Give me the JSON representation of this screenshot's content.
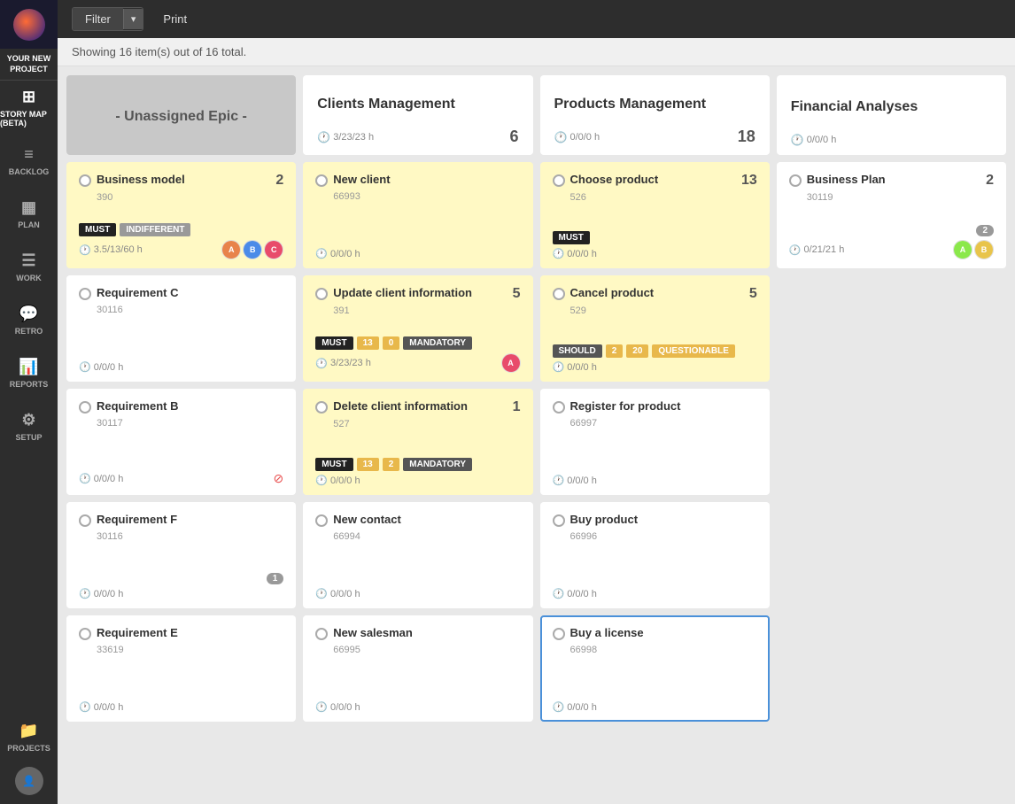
{
  "app": {
    "logo_text": "●",
    "project_name": "YOUR NEW PROJECT"
  },
  "sidebar": {
    "items": [
      {
        "id": "story-map",
        "label": "STORY MAP (BETA)",
        "icon": "⊞",
        "active": true
      },
      {
        "id": "backlog",
        "label": "BACKLOG",
        "icon": "≡"
      },
      {
        "id": "plan",
        "label": "PLAN",
        "icon": "▦"
      },
      {
        "id": "work",
        "label": "WORK",
        "icon": "☰"
      },
      {
        "id": "retro",
        "label": "RETRO",
        "icon": "💬"
      },
      {
        "id": "reports",
        "label": "REPORTS",
        "icon": "📊"
      },
      {
        "id": "setup",
        "label": "SETUP",
        "icon": "⚙"
      },
      {
        "id": "projects",
        "label": "PROJECTS",
        "icon": "📁"
      }
    ]
  },
  "toolbar": {
    "filter_label": "Filter",
    "print_label": "Print"
  },
  "status_bar": {
    "text": "Showing 16 item(s) out of 16 total."
  },
  "epics": [
    {
      "id": "unassigned",
      "title": "- Unassigned Epic -",
      "time": "",
      "count": "",
      "unassigned": true
    },
    {
      "id": "clients",
      "title": "Clients Management",
      "time": "3/23/23 h",
      "count": "6"
    },
    {
      "id": "products",
      "title": "Products Management",
      "time": "0/0/0 h",
      "count": "18"
    },
    {
      "id": "financial",
      "title": "Financial Analyses",
      "time": "0/0/0 h",
      "count": ""
    }
  ],
  "story_rows": [
    [
      {
        "title": "Business model",
        "id": "390",
        "count": "2",
        "yellow": true,
        "tags": [
          "MUST",
          "INDIFFERENT"
        ],
        "time": "3.5/13/60 h",
        "has_avatars": true,
        "avatars": [
          "av1",
          "av2",
          "av3"
        ],
        "has_warning": false,
        "badge": null
      },
      {
        "title": "New client",
        "id": "66993",
        "count": "",
        "yellow": true,
        "tags": [],
        "time": "0/0/0 h",
        "has_avatars": false,
        "avatars": [],
        "has_warning": false,
        "badge": null
      },
      {
        "title": "Choose product",
        "id": "526",
        "count": "13",
        "yellow": true,
        "tags": [
          "MUST"
        ],
        "time": "0/0/0 h",
        "has_avatars": false,
        "avatars": [],
        "has_warning": false,
        "badge": null
      },
      {
        "title": "Business Plan",
        "id": "30119",
        "count": "2",
        "yellow": false,
        "tags": [],
        "time": "0/21/21 h",
        "has_avatars": true,
        "avatars": [
          "av4",
          "av5"
        ],
        "has_warning": false,
        "badge": "2"
      }
    ],
    [
      {
        "title": "Requirement C",
        "id": "30116",
        "count": "",
        "yellow": false,
        "tags": [],
        "time": "0/0/0 h",
        "has_avatars": false,
        "avatars": [],
        "has_warning": false,
        "badge": null
      },
      {
        "title": "Update client information",
        "id": "391",
        "count": "5",
        "yellow": true,
        "tags": [
          "MUST",
          "13",
          "0",
          "MANDATORY"
        ],
        "time": "3/23/23 h",
        "has_avatars": true,
        "avatars": [
          "av3"
        ],
        "has_warning": false,
        "badge": null
      },
      {
        "title": "Cancel product",
        "id": "529",
        "count": "5",
        "yellow": true,
        "tags": [
          "SHOULD",
          "2",
          "20",
          "QUESTIONABLE"
        ],
        "time": "0/0/0 h",
        "has_avatars": false,
        "avatars": [],
        "has_warning": false,
        "badge": null
      },
      {
        "empty": true
      }
    ],
    [
      {
        "title": "Requirement B",
        "id": "30117",
        "count": "",
        "yellow": false,
        "tags": [],
        "time": "0/0/0 h",
        "has_avatars": false,
        "avatars": [],
        "has_warning": true,
        "badge": null
      },
      {
        "title": "Delete client information",
        "id": "527",
        "count": "1",
        "yellow": true,
        "tags": [
          "MUST",
          "13",
          "2",
          "MANDATORY"
        ],
        "time": "0/0/0 h",
        "has_avatars": false,
        "avatars": [],
        "has_warning": false,
        "badge": null
      },
      {
        "title": "Register for product",
        "id": "66997",
        "count": "",
        "yellow": false,
        "tags": [],
        "time": "0/0/0 h",
        "has_avatars": false,
        "avatars": [],
        "has_warning": false,
        "badge": null
      },
      {
        "empty": true
      }
    ],
    [
      {
        "title": "Requirement F",
        "id": "30116",
        "count": "",
        "yellow": false,
        "tags": [],
        "time": "0/0/0 h",
        "has_avatars": false,
        "avatars": [],
        "has_warning": false,
        "badge": "1"
      },
      {
        "title": "New contact",
        "id": "66994",
        "count": "",
        "yellow": false,
        "tags": [],
        "time": "0/0/0 h",
        "has_avatars": false,
        "avatars": [],
        "has_warning": false,
        "badge": null
      },
      {
        "title": "Buy product",
        "id": "66996",
        "count": "",
        "yellow": false,
        "tags": [],
        "time": "0/0/0 h",
        "has_avatars": false,
        "avatars": [],
        "has_warning": false,
        "badge": null
      },
      {
        "empty": true
      }
    ],
    [
      {
        "title": "Requirement E",
        "id": "33619",
        "count": "",
        "yellow": false,
        "tags": [],
        "time": "0/0/0 h",
        "has_avatars": false,
        "avatars": [],
        "has_warning": false,
        "badge": null
      },
      {
        "title": "New salesman",
        "id": "66995",
        "count": "",
        "yellow": false,
        "tags": [],
        "time": "0/0/0 h",
        "has_avatars": false,
        "avatars": [],
        "has_warning": false,
        "badge": null
      },
      {
        "title": "Buy a license",
        "id": "66998",
        "count": "",
        "yellow": false,
        "selected": true,
        "tags": [],
        "time": "0/0/0 h",
        "has_avatars": false,
        "avatars": [],
        "has_warning": false,
        "badge": null
      },
      {
        "empty": true
      }
    ]
  ]
}
